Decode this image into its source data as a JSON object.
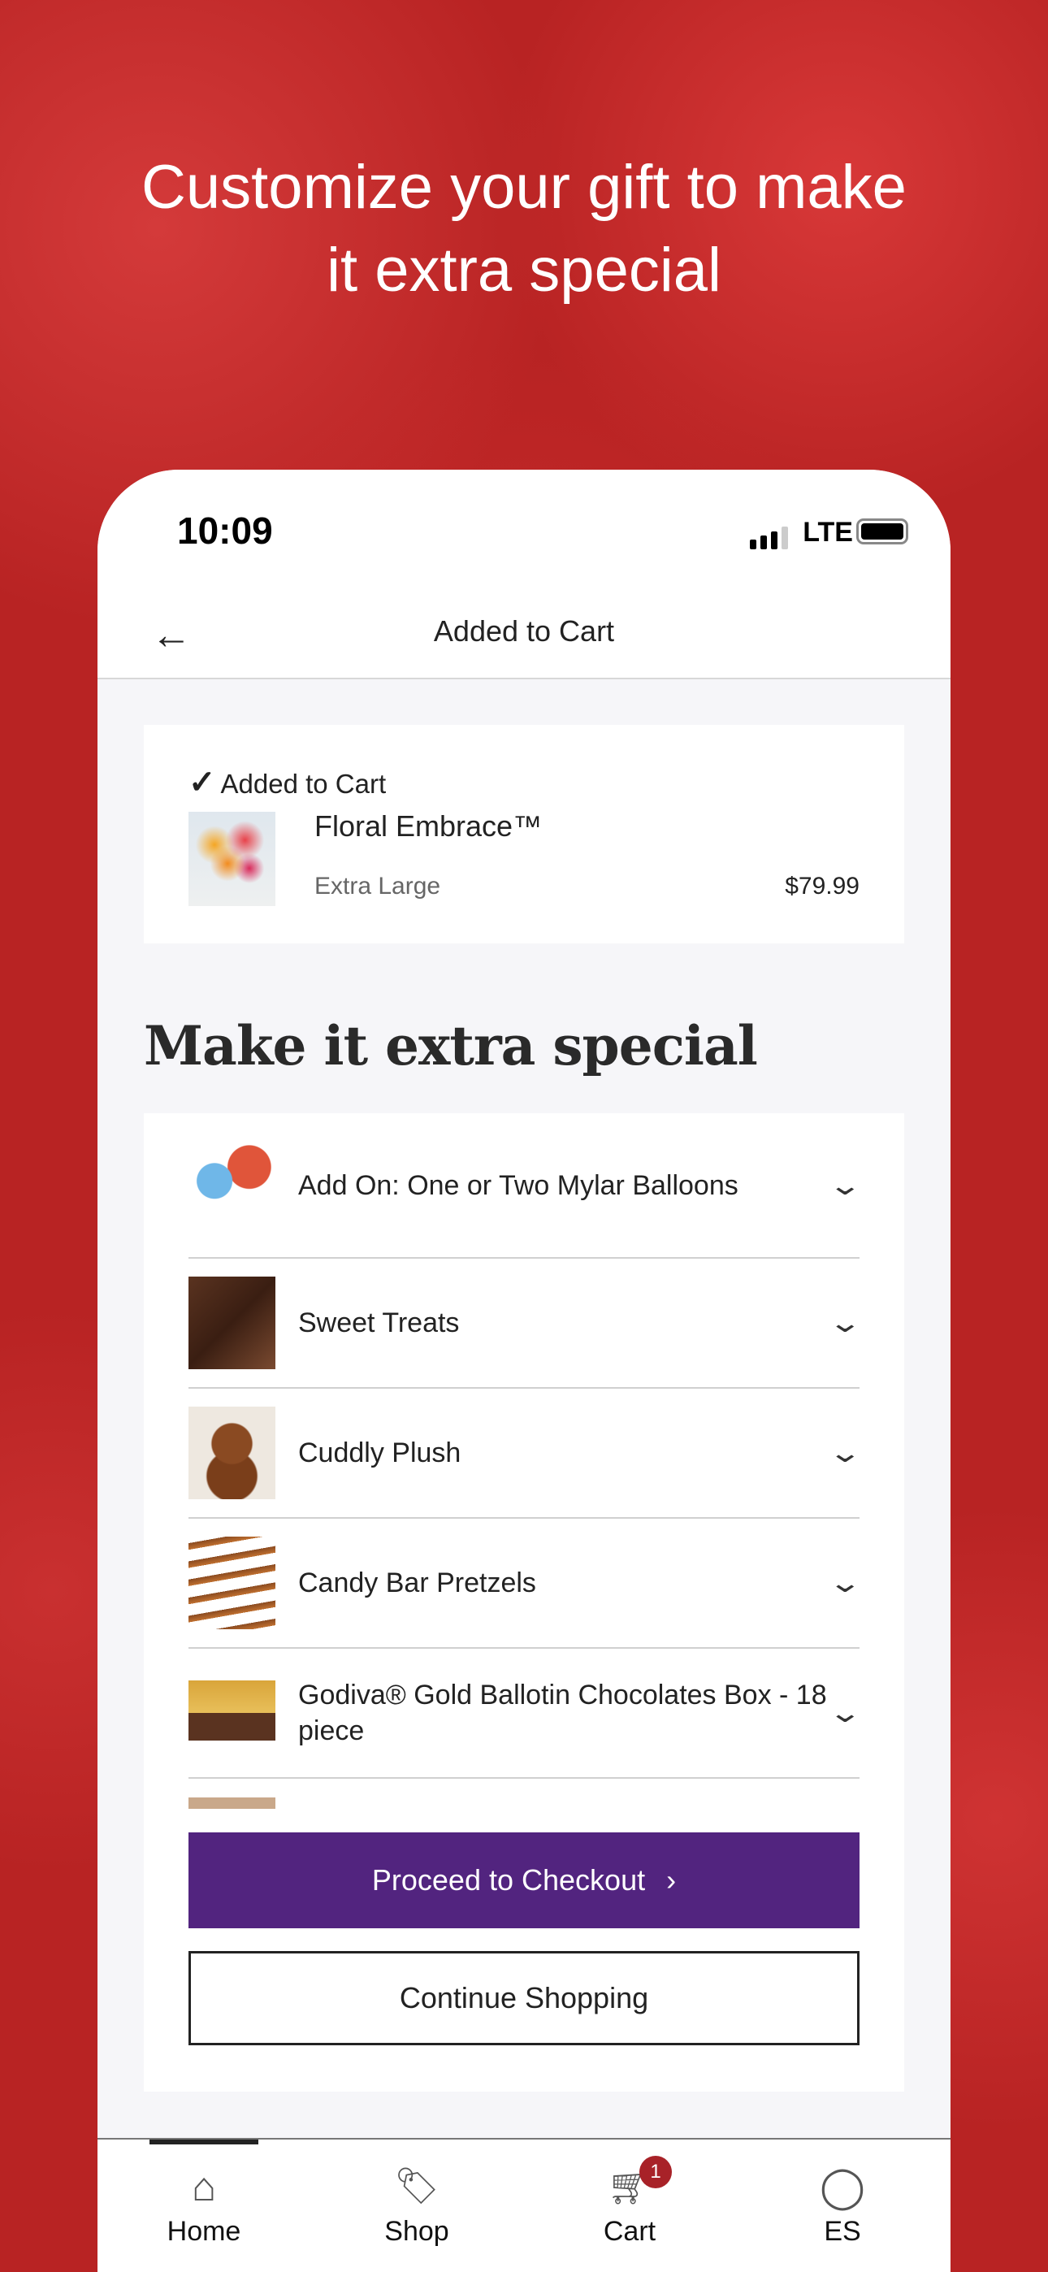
{
  "headline": [
    "Customize your gift to make",
    "it extra special"
  ],
  "status": {
    "time": "10:09",
    "network": "LTE"
  },
  "nav": {
    "title": "Added to Cart"
  },
  "added": {
    "label": "Added to Cart",
    "product": "Floral Embrace™",
    "variant": "Extra Large",
    "price": "$79.99"
  },
  "section_title": "Make it extra special",
  "addons": [
    {
      "label": "Add On: One or Two Mylar Balloons"
    },
    {
      "label": "Sweet Treats"
    },
    {
      "label": "Cuddly Plush"
    },
    {
      "label": "Candy Bar Pretzels"
    },
    {
      "label": "Godiva® Gold Ballotin Chocolates Box - 18 piece"
    }
  ],
  "buttons": {
    "checkout": "Proceed to Checkout",
    "continue": "Continue Shopping"
  },
  "tabs": [
    {
      "label": "Home",
      "icon": "home-icon"
    },
    {
      "label": "Shop",
      "icon": "tag-icon"
    },
    {
      "label": "Cart",
      "icon": "cart-icon",
      "badge": "1"
    },
    {
      "label": "ES",
      "icon": "user-icon"
    }
  ],
  "colors": {
    "accent": "#52247f",
    "badge": "#a82228",
    "background": "#b82323"
  }
}
